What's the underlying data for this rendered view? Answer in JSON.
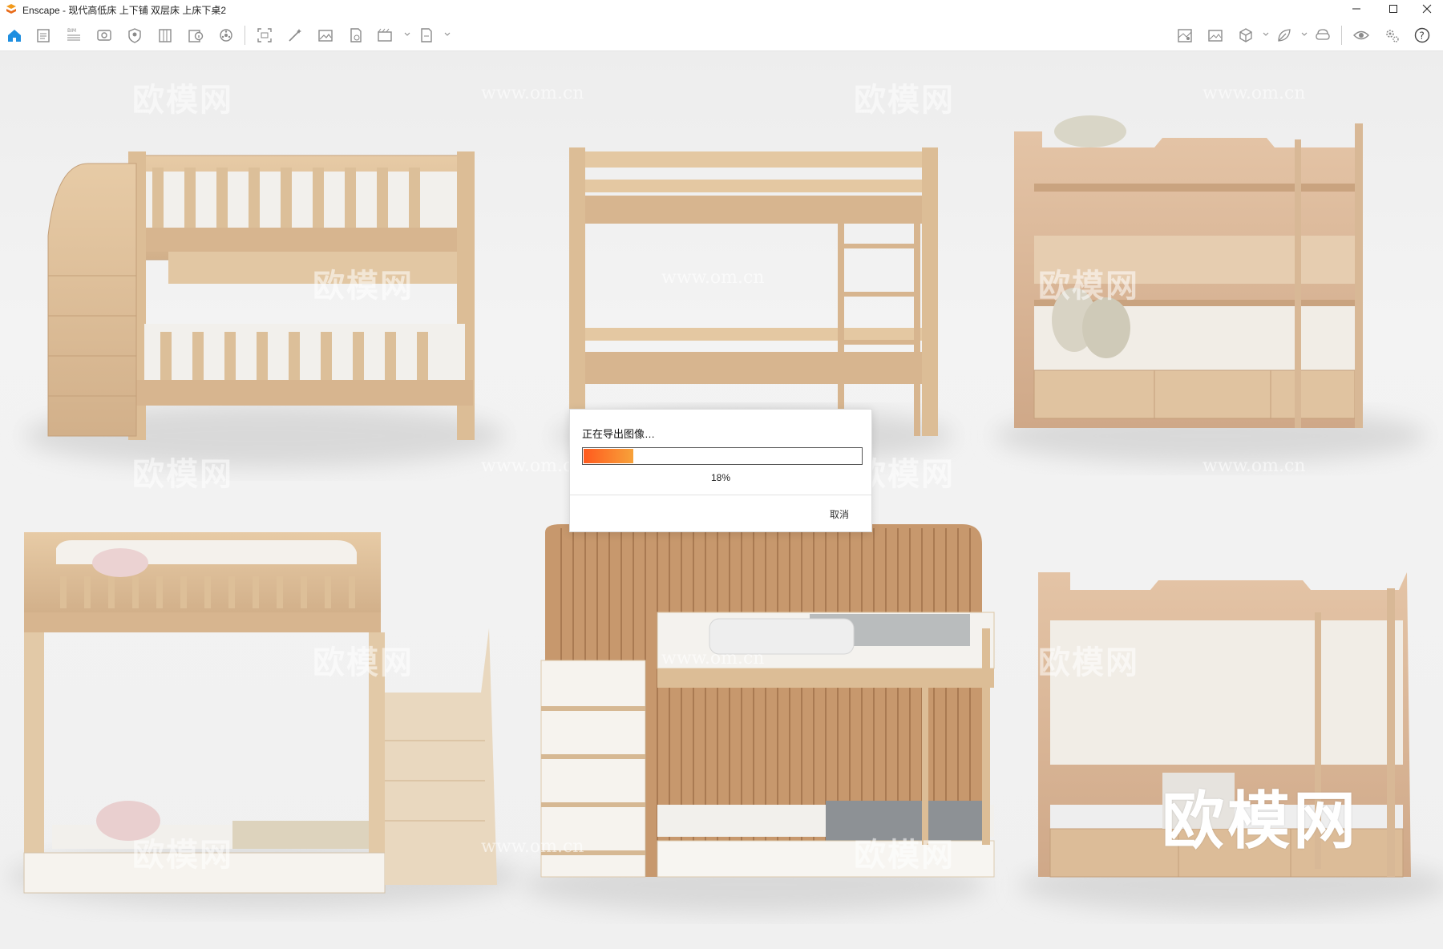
{
  "titlebar": {
    "title": "Enscape - 现代高低床 上下铺 双层床 上床下桌2",
    "minimize_icon": "minimize-icon",
    "maximize_icon": "maximize-icon",
    "close_icon": "close-icon"
  },
  "toolbar": {
    "left_icons": [
      "home-icon",
      "project-icon",
      "bim-icon",
      "view-icon",
      "asset-icon",
      "library-icon",
      "info-icon",
      "settings-wheel-icon",
      "screenshot-icon",
      "magic-icon",
      "image-icon",
      "batch-icon",
      "video-icon",
      "export-icon"
    ],
    "right_icons": [
      "map-icon",
      "gallery-icon",
      "cube-icon",
      "leaf-icon",
      "vr-icon",
      "eye-icon",
      "gear-icon",
      "help-icon"
    ],
    "accent": "#1f8fe0"
  },
  "watermarks": {
    "brand": "欧模网",
    "url": "www.om.cn",
    "big": "欧模网"
  },
  "dialog": {
    "message": "正在导出图像…",
    "progress_fraction": 0.18,
    "progress_text": "18%",
    "cancel_label": "取消"
  }
}
